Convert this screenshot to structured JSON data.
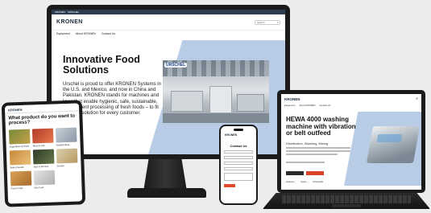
{
  "monitor": {
    "topbar_items": [
      "KRONEN",
      "URSCHEL"
    ],
    "logo": "KRONEN",
    "search_label": "Search",
    "nav": [
      "Equipment",
      "About KRONEN",
      "Contact Us"
    ],
    "hero_title": "Innovative Food Solutions",
    "hero_body": "Urschel is proud to offer KRONEN Systems in the U.S. and Mexico, and now in China and Pakistan. KRONEN stands for machines and lines that enable hygienic, safe, sustainable, and efficient processing of fresh foods – to fit the right solution for every customer.",
    "photo_brand": "URSCHEL"
  },
  "tablet": {
    "logo": "KRONEN",
    "title": "What product do you want to process?",
    "tiles": [
      "Vegetables & Fruits",
      "Meat & Fish",
      "Salad/Lettuce",
      "Baked Goods",
      "Nuts & Kernels",
      "Snacks",
      "Fried Foods",
      "Dry Food"
    ]
  },
  "phone": {
    "logo": "KRONEN",
    "title": "Contact Us"
  },
  "laptop": {
    "logo": "KRONEN",
    "nav": [
      "Equipment",
      "About KRONEN",
      "Contact Us"
    ],
    "title": "HEWA 4000 washing machine with vibration or belt outfeed",
    "subtitle": "Disinfection, Washing, Mixing",
    "tabs": [
      "Features",
      "Specs",
      "Downloads"
    ]
  },
  "colors": {
    "hero_blue": "#b8cce6",
    "brand_red": "#d9432a",
    "dark_frame": "#1b1b1b"
  }
}
